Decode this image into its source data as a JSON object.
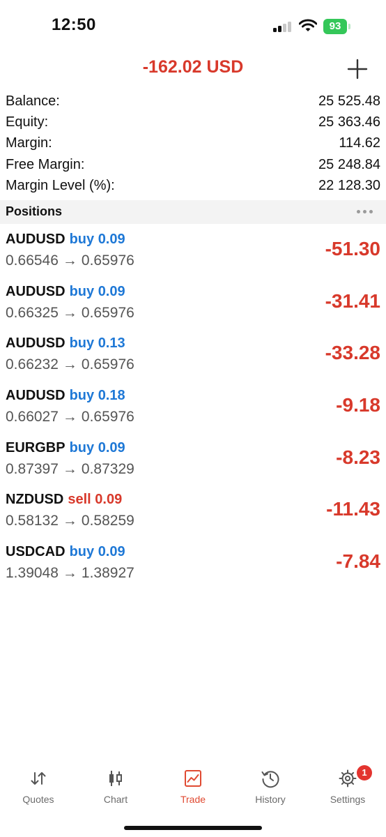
{
  "status": {
    "time": "12:50",
    "battery": "93"
  },
  "header": {
    "title": "-162.02 USD"
  },
  "summary": [
    {
      "label": "Balance:",
      "value": "25 525.48"
    },
    {
      "label": "Equity:",
      "value": "25 363.46"
    },
    {
      "label": "Margin:",
      "value": "114.62"
    },
    {
      "label": "Free Margin:",
      "value": "25 248.84"
    },
    {
      "label": "Margin Level (%):",
      "value": "22 128.30"
    }
  ],
  "section": {
    "title": "Positions"
  },
  "positions": [
    {
      "symbol": "AUDUSD",
      "side": "buy",
      "volume": "0.09",
      "open": "0.66546",
      "arrow": "→",
      "current": "0.65976",
      "profit": "-51.30"
    },
    {
      "symbol": "AUDUSD",
      "side": "buy",
      "volume": "0.09",
      "open": "0.66325",
      "arrow": "→",
      "current": "0.65976",
      "profit": "-31.41"
    },
    {
      "symbol": "AUDUSD",
      "side": "buy",
      "volume": "0.13",
      "open": "0.66232",
      "arrow": "→",
      "current": "0.65976",
      "profit": "-33.28"
    },
    {
      "symbol": "AUDUSD",
      "side": "buy",
      "volume": "0.18",
      "open": "0.66027",
      "arrow": "→",
      "current": "0.65976",
      "profit": "-9.18"
    },
    {
      "symbol": "EURGBP",
      "side": "buy",
      "volume": "0.09",
      "open": "0.87397",
      "arrow": "→",
      "current": "0.87329",
      "profit": "-8.23"
    },
    {
      "symbol": "NZDUSD",
      "side": "sell",
      "volume": "0.09",
      "open": "0.58132",
      "arrow": "→",
      "current": "0.58259",
      "profit": "-11.43"
    },
    {
      "symbol": "USDCAD",
      "side": "buy",
      "volume": "0.09",
      "open": "1.39048",
      "arrow": "→",
      "current": "1.38927",
      "profit": "-7.84"
    }
  ],
  "tabs": [
    {
      "label": "Quotes",
      "icon": "quotes-arrows-icon"
    },
    {
      "label": "Chart",
      "icon": "candlestick-icon"
    },
    {
      "label": "Trade",
      "icon": "trade-chart-icon"
    },
    {
      "label": "History",
      "icon": "history-clock-icon"
    },
    {
      "label": "Settings",
      "icon": "gear-icon",
      "badge": "1"
    }
  ],
  "colors": {
    "loss": "#d8392b",
    "buy": "#1e78d6",
    "active_tab": "#e04a32",
    "battery": "#34c759"
  }
}
